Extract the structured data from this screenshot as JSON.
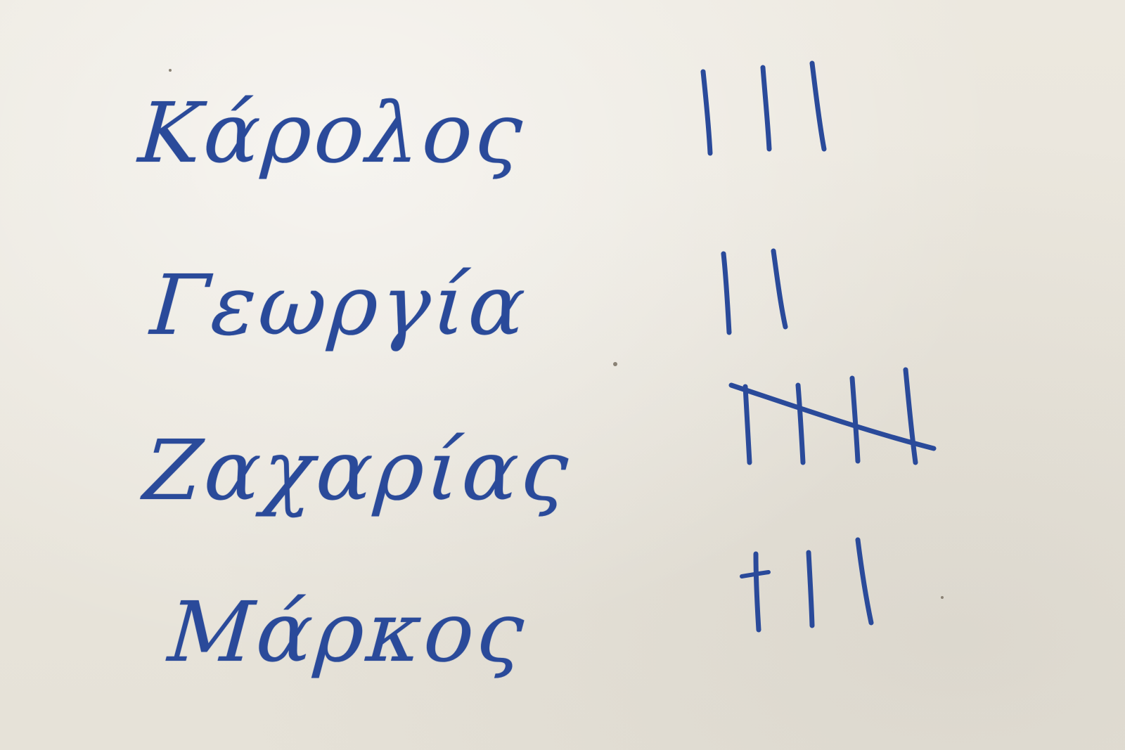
{
  "ink_color": "#2a4a9a",
  "paper_color": "#e9e5dc",
  "tally_rows": [
    {
      "name": "Κάρολος",
      "count": 3
    },
    {
      "name": "Γεωργία",
      "count": 2
    },
    {
      "name": "Ζαχαρίας",
      "count": 5
    },
    {
      "name": "Μάρκος",
      "count": 3
    }
  ]
}
